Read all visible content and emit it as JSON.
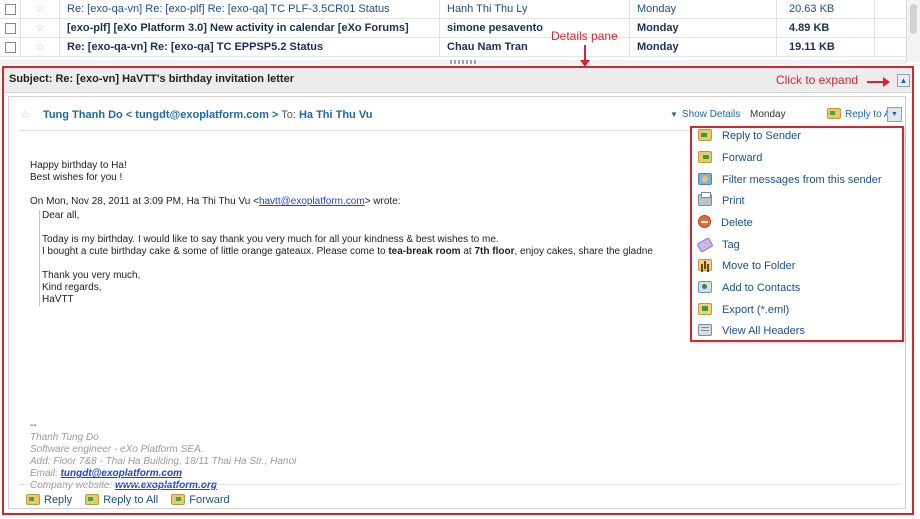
{
  "message_list": {
    "rows": [
      {
        "subject": "Re: [exo-qa-vn] Re: [exo-plf] Re: [exo-qa] TC PLF-3.5CR01 Status",
        "from": "Hanh Thi Thu Ly",
        "day": "Monday",
        "size": "20.63 KB",
        "unread": false
      },
      {
        "subject": "[exo-plf] [eXo Platform 3.0] New activity in calendar [eXo Forums]",
        "from": "simone pesavento",
        "day": "Monday",
        "size": "4.89 KB",
        "unread": true
      },
      {
        "subject": "Re: [exo-qa-vn] Re: [exo-qa] TC EPPSP5.2 Status",
        "from": "Chau Nam Tran",
        "day": "Monday",
        "size": "19.11 KB",
        "unread": true
      }
    ]
  },
  "details": {
    "subject": "Subject: Re: [exo-vn] HaVTT's birthday invitation letter",
    "sender": "Tung Thanh Do < tungdt@exoplatform.com >",
    "to_label": "To:",
    "recipient": "Ha Thi Thu Vu",
    "show_details": "Show Details",
    "day": "Monday",
    "reply_all_top": "Reply to All",
    "body": {
      "line1": "Happy birthday to Ha!",
      "line2": "Best wishes for you !",
      "wrote_prefix": "On Mon, Nov 28, 2011 at 3:09 PM, Ha Thi Thu Vu <",
      "wrote_email": "havtt@exoplatform.com",
      "wrote_suffix": "> wrote:",
      "q_greeting": "Dear all,",
      "q_p1": "Today is my birthday. I would like to say thank you very much for all your kindness & best wishes to me.",
      "q_p2_a": "I bought a cute birthday cake & some of little orange gateaux. Please come to ",
      "q_p2_b": "tea-break room",
      "q_p2_c": " at ",
      "q_p2_d": "7th floor",
      "q_p2_e": ", enjoy cakes, share the gladne",
      "q_thanks": "Thank you very much,",
      "q_regards": "Kind regards,",
      "q_name": "HaVTT"
    },
    "signature": {
      "dash": "--",
      "name": "Thanh Tung Do",
      "role": "Software engineer - eXo Platform SEA.",
      "address": "Add: Floor 7&8 - Thai Ha Building, 18/11 Thai Ha Str., Hanoi",
      "email_label": "Email: ",
      "email": "tungdt@exoplatform.com",
      "website_label": "Company website: ",
      "website": "www.exoplatform.org"
    },
    "footer": {
      "reply": "Reply",
      "reply_all": "Reply to All",
      "forward": "Forward"
    }
  },
  "menu": {
    "items": [
      {
        "label": "Reply to Sender",
        "icon": "reply-icon"
      },
      {
        "label": "Forward",
        "icon": "forward-icon"
      },
      {
        "label": "Filter messages from this sender",
        "icon": "filter-icon"
      },
      {
        "label": "Print",
        "icon": "print-icon"
      },
      {
        "label": "Delete",
        "icon": "delete-icon"
      },
      {
        "label": "Tag",
        "icon": "tag-icon"
      },
      {
        "label": "Move to Folder",
        "icon": "move-folder-icon"
      },
      {
        "label": "Add to Contacts",
        "icon": "add-contact-icon"
      },
      {
        "label": "Export (*.eml)",
        "icon": "export-icon"
      },
      {
        "label": "View All Headers",
        "icon": "headers-icon"
      }
    ]
  },
  "annotations": {
    "details_pane": "Details pane",
    "click_to_expand": "Click to expand"
  },
  "colors": {
    "annotation_red": "#d0282e",
    "link_blue": "#1c6aa6"
  }
}
